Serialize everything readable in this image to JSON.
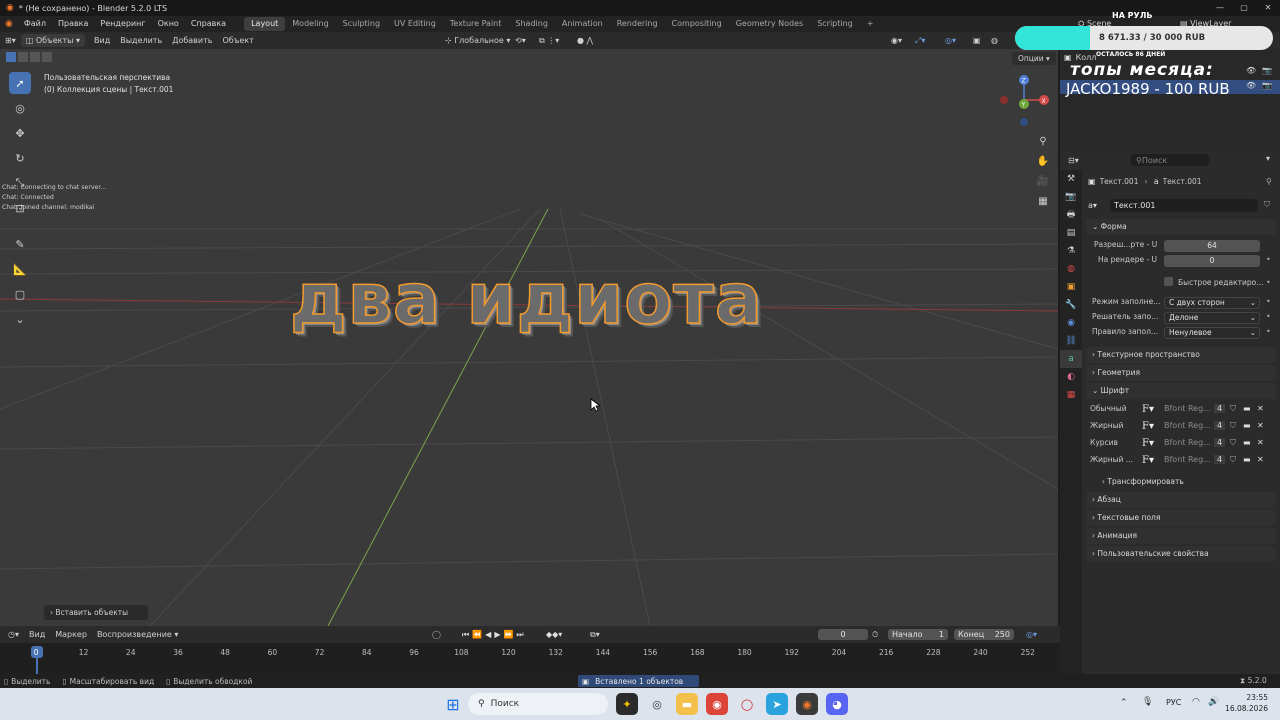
{
  "titlebar": {
    "title": "* (Не сохранено) - Blender 5.2.0 LTS",
    "minimize": "—",
    "maximize": "▢",
    "close": "✕"
  },
  "menubar": {
    "menus": [
      "Файл",
      "Правка",
      "Рендеринг",
      "Окно",
      "Справка"
    ],
    "workspaces": [
      "Layout",
      "Modeling",
      "Sculpting",
      "UV Editing",
      "Texture Paint",
      "Shading",
      "Animation",
      "Rendering",
      "Compositing",
      "Geometry Nodes",
      "Scripting"
    ],
    "add_tab": "+",
    "scene": "Scene",
    "view_layer": "ViewLayer"
  },
  "viewport_header": {
    "mode": "Объекты",
    "menus": [
      "Вид",
      "Выделить",
      "Добавить",
      "Объект"
    ],
    "orientation": "Глобальное",
    "options": "Опции"
  },
  "viewport": {
    "view_name": "Пользовательская перспектива",
    "collection": "(0) Коллекция сцены | Текст.001",
    "text_object": "два идиота",
    "last_operator": "Вставить объекты",
    "chat_log": [
      "Chat: Connecting to chat server...",
      "Chat: Connected",
      "Chat: Joined channel: modikai"
    ]
  },
  "gizmo": {
    "x": "X",
    "y": "Y",
    "z": "Z"
  },
  "overlay": {
    "title": "НА РУЛЬ",
    "progress": "8 671.33 / 30 000 RUB",
    "progress_fraction": 0.289,
    "subtitle": "ОСТАЛОСЬ 86 ДНЕЙ",
    "tops": "топы месяца:",
    "top_donor": "JACKO1989 - 100 RUB"
  },
  "outliner": {
    "row_label": "Колл"
  },
  "properties": {
    "search_placeholder": "Поиск",
    "breadcrumb_object": "Текст.001",
    "breadcrumb_data": "Текст.001",
    "datablock": "Текст.001",
    "sections": {
      "shape": "Форма",
      "texture_space": "Текстурное пространство",
      "geometry": "Геометрия",
      "font": "Шрифт",
      "transform": "Трансформировать",
      "paragraph": "Абзац",
      "text_boxes": "Текстовые поля",
      "animation": "Анимация",
      "custom_props": "Пользовательские свойства"
    },
    "shape": {
      "res_u_label": "Разреш...рте - U",
      "res_u_value": "64",
      "render_u_label": "На рендере - U",
      "render_u_value": "0",
      "fast_edit_label": "Быстрое редактиро...",
      "fill_mode_label": "Режим заполне...",
      "fill_mode_value": "С двух сторон",
      "solver_label": "Решатель запо...",
      "solver_value": "Делоне",
      "fill_rule_label": "Правило запол...",
      "fill_rule_value": "Ненулевое"
    },
    "fonts": [
      {
        "label": "Обычный",
        "font": "Bfont Reg...",
        "users": "4"
      },
      {
        "label": "Жирный",
        "font": "Bfont Reg...",
        "users": "4"
      },
      {
        "label": "Курсив",
        "font": "Bfont Reg...",
        "users": "4"
      },
      {
        "label": "Жирный ...",
        "font": "Bfont Reg...",
        "users": "4"
      }
    ]
  },
  "timeline": {
    "menus": [
      "Вид",
      "Маркер",
      "Воспроизведение"
    ],
    "current_frame": "0",
    "start_label": "Начало",
    "start_value": "1",
    "end_label": "Конец",
    "end_value": "250",
    "ticks": [
      "0",
      "12",
      "24",
      "36",
      "48",
      "60",
      "72",
      "84",
      "96",
      "108",
      "120",
      "132",
      "144",
      "156",
      "168",
      "180",
      "192",
      "204",
      "216",
      "228",
      "240",
      "252"
    ]
  },
  "statusbar": {
    "hints": [
      "Выделить",
      "Масштабировать вид",
      "Выделить обводкой"
    ],
    "message": "Вставлено 1 объектов",
    "version": "5.2.0"
  },
  "taskbar": {
    "search_placeholder": "Поиск",
    "language": "РУС",
    "time": "23:55",
    "date": "16.08.2026"
  },
  "colors": {
    "accent": "#4772b3",
    "selection_outline": "#f29a2e",
    "viewport_bg": "#3a3a3a",
    "donation_fill": "#33e5d9"
  }
}
